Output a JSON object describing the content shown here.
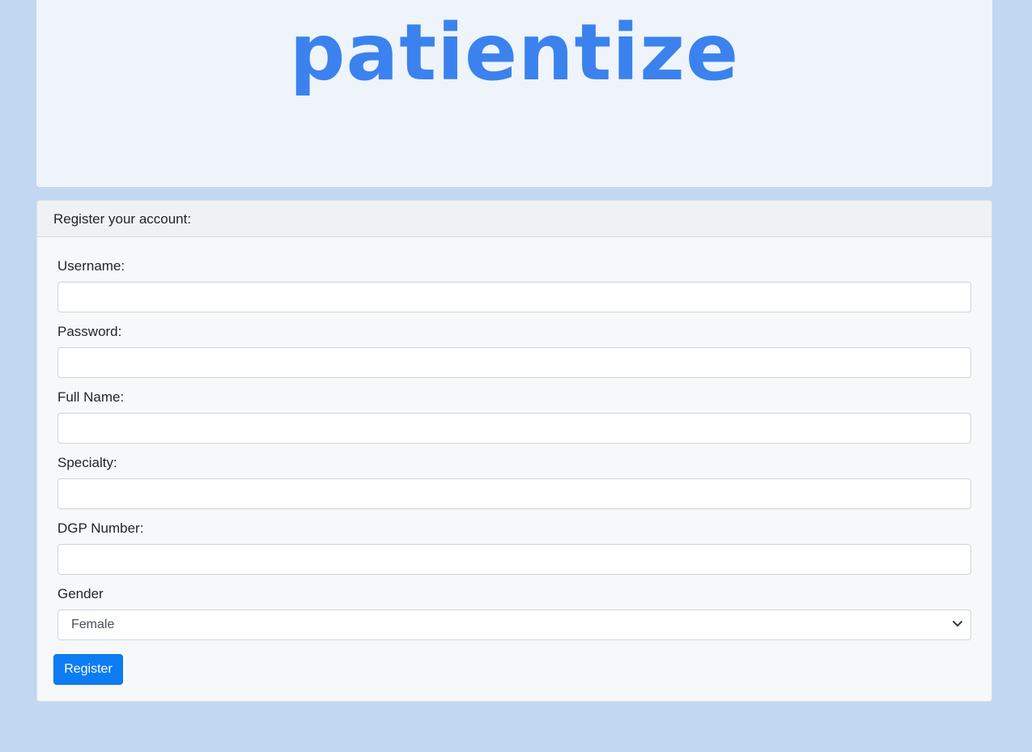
{
  "brand": {
    "logo_text": "patientize",
    "color": "#3b82ee"
  },
  "form": {
    "header": "Register your account:",
    "fields": [
      {
        "label": "Username:",
        "value": "",
        "placeholder": ""
      },
      {
        "label": "Password:",
        "value": "",
        "placeholder": ""
      },
      {
        "label": "Full Name:",
        "value": "",
        "placeholder": ""
      },
      {
        "label": "Specialty:",
        "value": "",
        "placeholder": ""
      },
      {
        "label": "DGP Number:",
        "value": "",
        "placeholder": ""
      }
    ],
    "gender": {
      "label": "Gender",
      "selected": "Female",
      "icon": "chevron-down-icon"
    },
    "submit_label": "Register",
    "accent_color": "#0d7cf2"
  }
}
